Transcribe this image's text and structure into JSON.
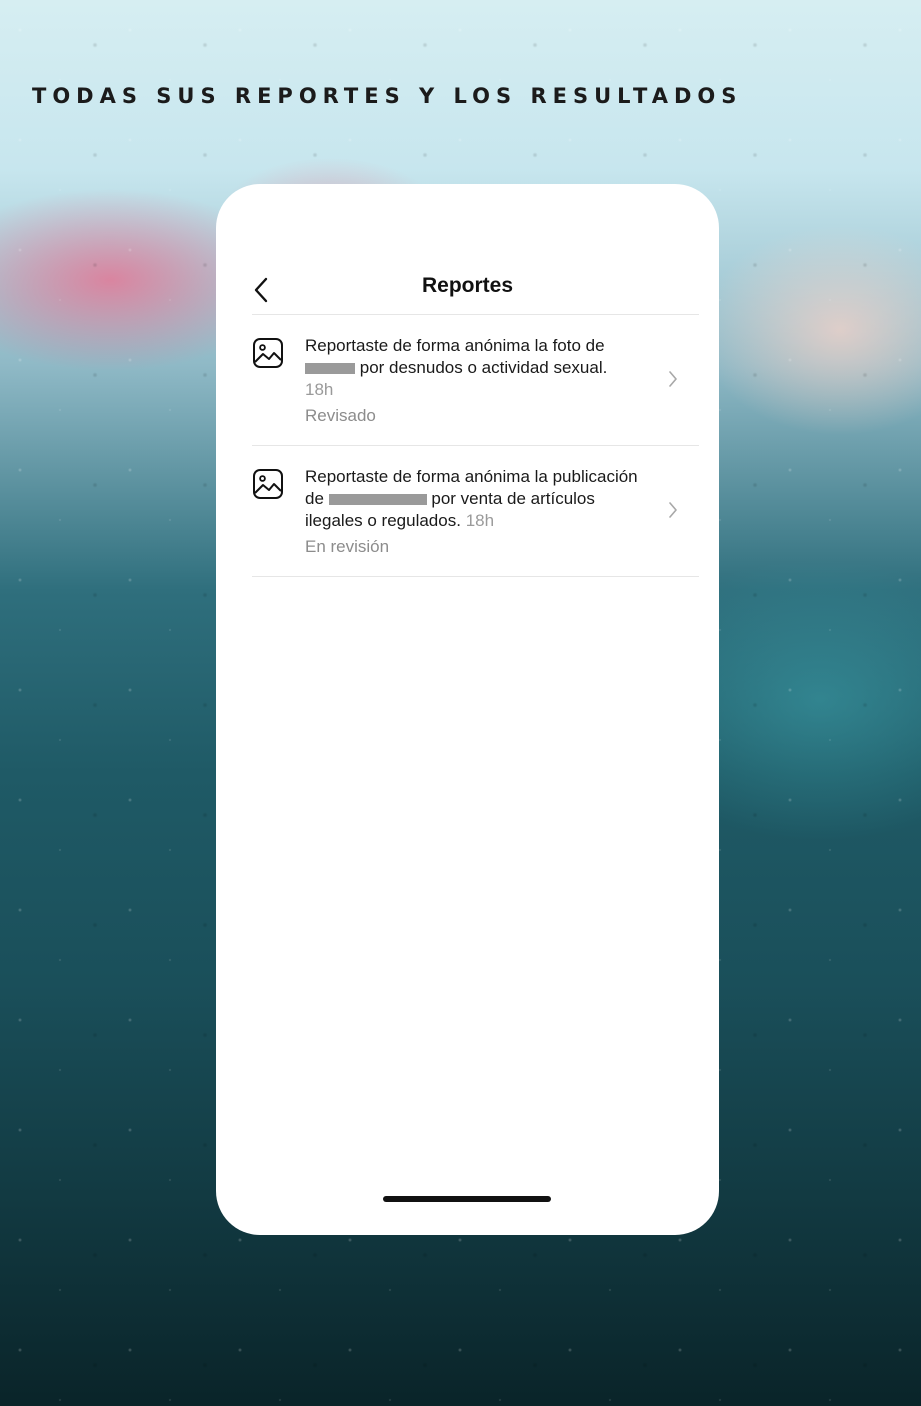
{
  "headline": "TODAS SUS REPORTES Y LOS RESULTADOS",
  "screen": {
    "title": "Reportes",
    "back_icon": "chevron-left-icon"
  },
  "reports": [
    {
      "icon": "image-icon",
      "text_before": "Reportaste de forma anónima la foto de",
      "text_after": "por desnudos o actividad sexual.",
      "time": "18h",
      "status": "Revisado"
    },
    {
      "icon": "image-icon",
      "text_before": "Reportaste de forma anónima la publicación de",
      "text_after": "por venta de artículos ilegales o regulados.",
      "time": "18h",
      "status": "En revisión"
    }
  ],
  "colors": {
    "redaction": "#9a9a9a",
    "muted_text": "#9a9a9a",
    "divider": "#e6e6e6"
  }
}
